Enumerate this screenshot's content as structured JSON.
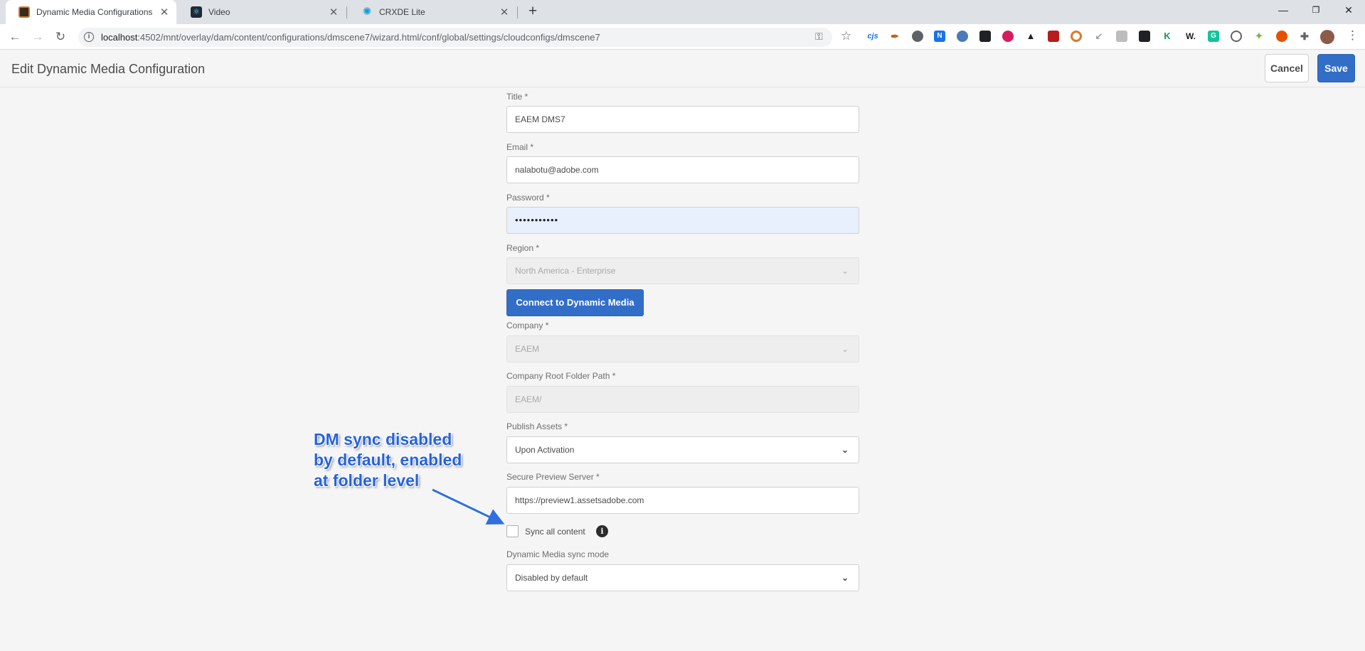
{
  "browser": {
    "tabs": [
      {
        "title": "Dynamic Media Configurations",
        "active": true
      },
      {
        "title": "Video",
        "active": false
      },
      {
        "title": "CRXDE Lite",
        "active": false
      }
    ],
    "url_host": "localhost",
    "url_rest": ":4502/mnt/overlay/dam/content/configurations/dmscene7/wizard.html/conf/global/settings/cloudconfigs/dmscene7",
    "extensions": [
      "cjs",
      "pen",
      "circle",
      "N",
      "shield",
      "hat",
      "eye",
      "delta",
      "gift",
      "target",
      "arrow",
      "box",
      "bot",
      "K",
      "W.",
      "G",
      "G2",
      "leaf",
      "fox",
      "puzzle"
    ]
  },
  "header": {
    "title": "Edit Dynamic Media Configuration",
    "cancel_label": "Cancel",
    "save_label": "Save"
  },
  "form": {
    "title": {
      "label": "Title *",
      "value": "EAEM DMS7"
    },
    "email": {
      "label": "Email *",
      "value": "nalabotu@adobe.com"
    },
    "password": {
      "label": "Password *",
      "value": "•••••••••••"
    },
    "region": {
      "label": "Region *",
      "value": "North America - Enterprise"
    },
    "connect_label": "Connect to Dynamic Media",
    "company": {
      "label": "Company *",
      "value": "EAEM"
    },
    "root_path": {
      "label": "Company Root Folder Path *",
      "value": "EAEM/"
    },
    "publish_assets": {
      "label": "Publish Assets *",
      "value": "Upon Activation"
    },
    "preview_server": {
      "label": "Secure Preview Server *",
      "value": "https://preview1.assetsadobe.com"
    },
    "sync_all": {
      "label": "Sync all content",
      "checked": false
    },
    "sync_mode": {
      "label": "Dynamic Media sync mode",
      "value": "Disabled by default"
    }
  },
  "annotation": {
    "line1": "DM sync disabled",
    "line2": "by default, enabled",
    "line3": "at folder level"
  },
  "colors": {
    "accent": "#326ec8",
    "annotation": "#2563d8"
  }
}
